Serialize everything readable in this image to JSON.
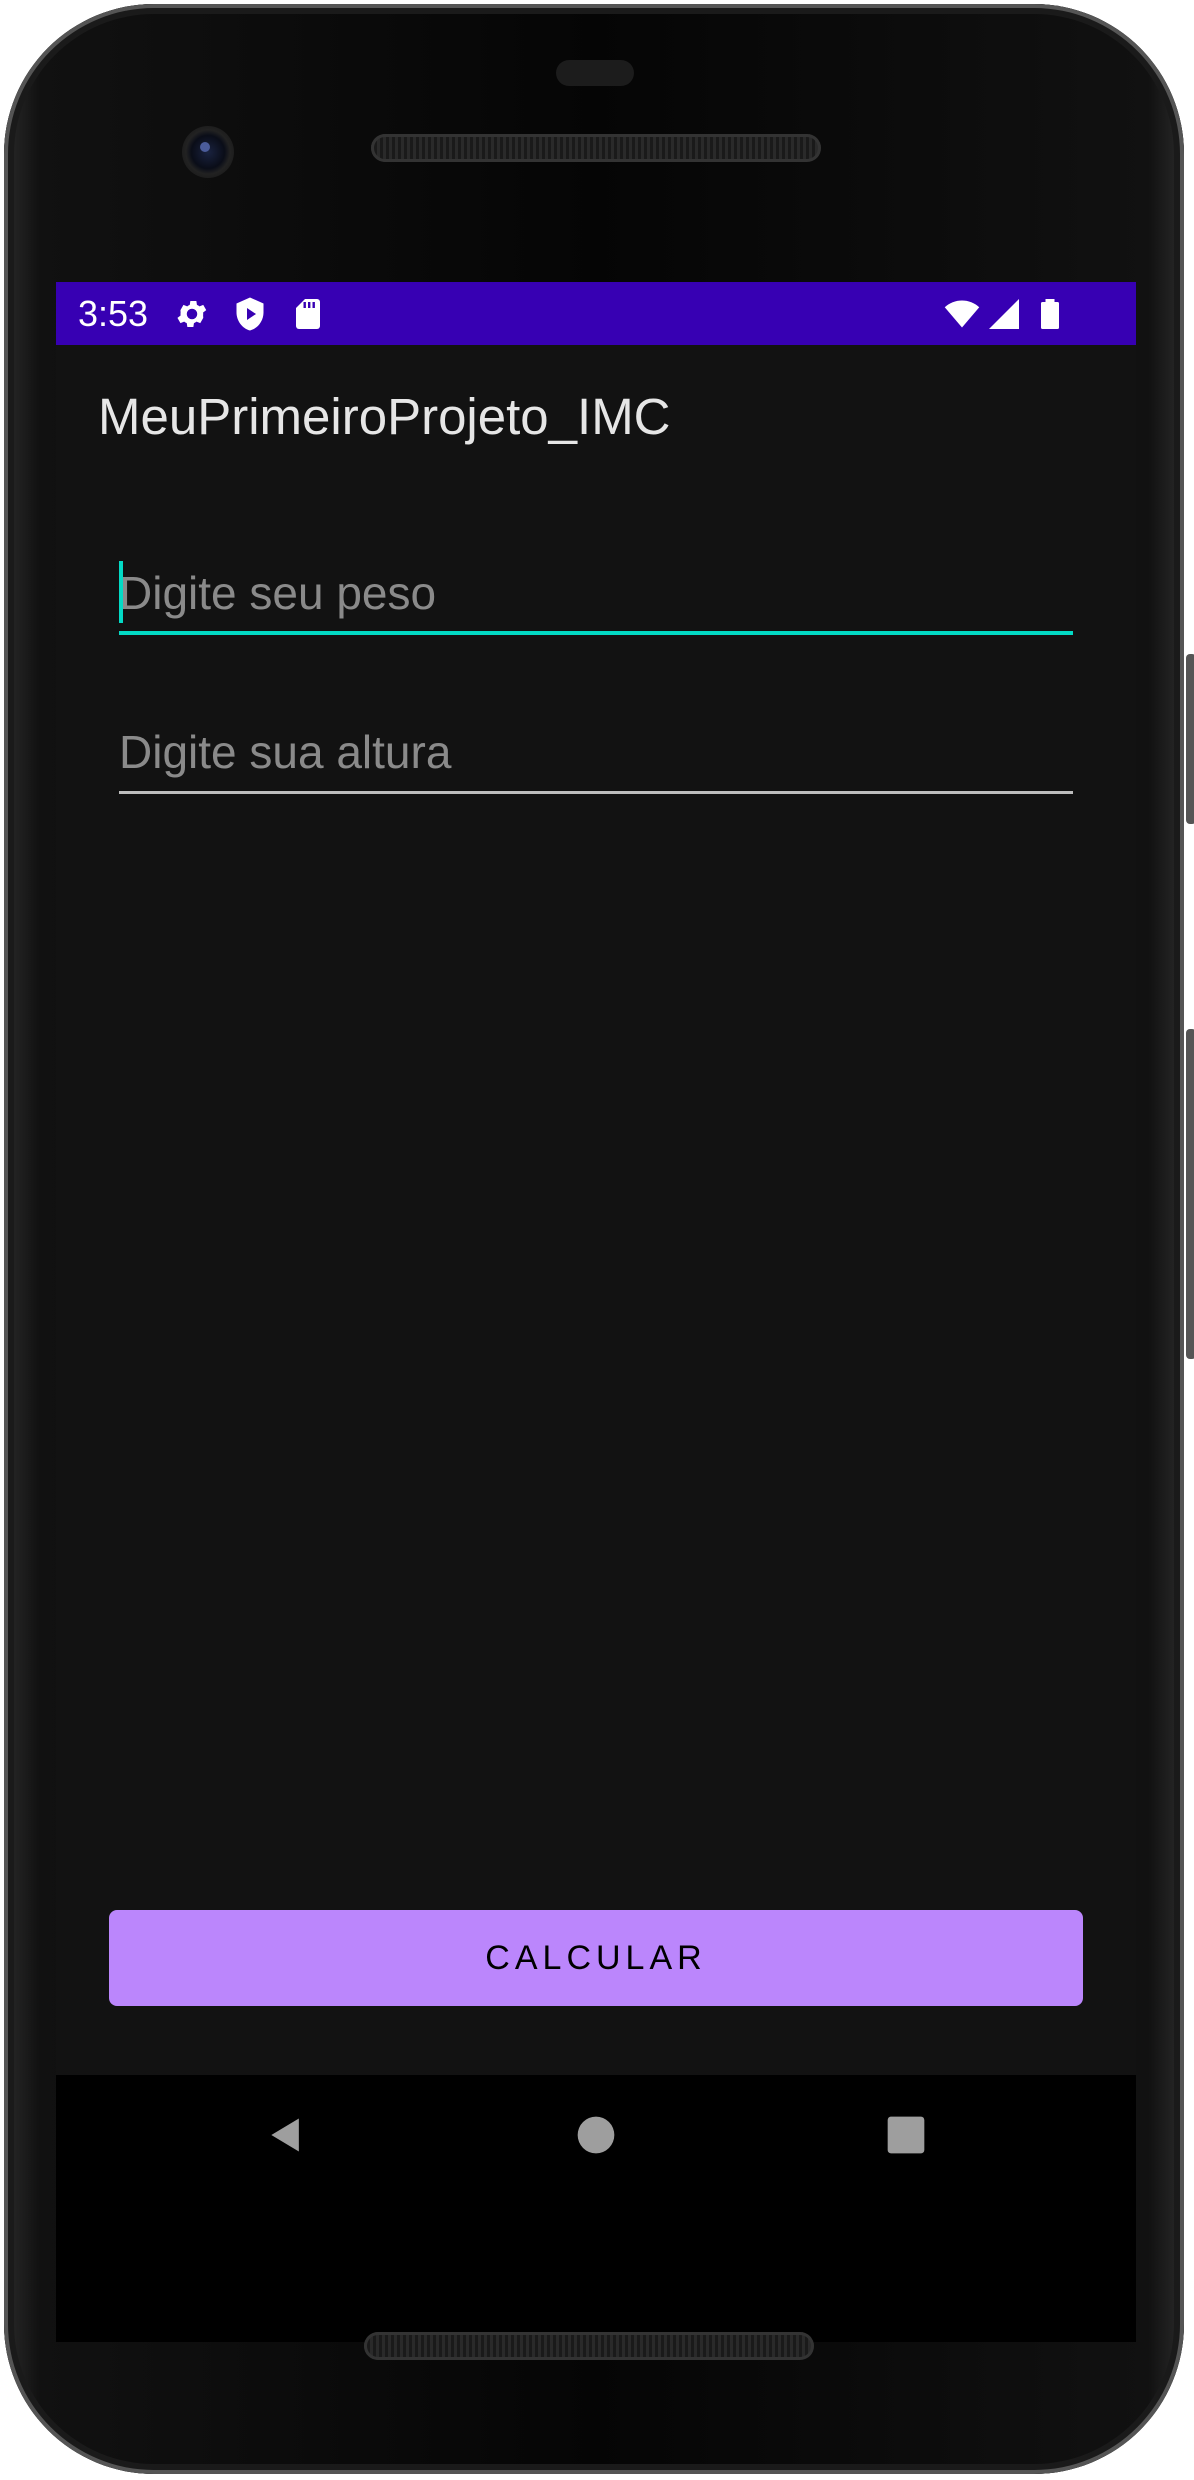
{
  "status_bar": {
    "time": "3:53",
    "background_color": "#3700b3",
    "left_icons": [
      "gear-icon",
      "shield-play-icon",
      "sd-card-icon"
    ],
    "right_icons": [
      "wifi-icon",
      "signal-icon",
      "battery-icon"
    ]
  },
  "app_bar": {
    "title": "MeuPrimeiroProjeto_IMC"
  },
  "form": {
    "weight": {
      "placeholder": "Digite seu peso",
      "value": "",
      "focused": true
    },
    "height": {
      "placeholder": "Digite sua altura",
      "value": "",
      "focused": false
    },
    "calculate_label": "CALCULAR"
  },
  "nav_bar": {
    "buttons": [
      "back-icon",
      "home-icon",
      "recents-icon"
    ]
  },
  "colors": {
    "background": "#121212",
    "accent": "#03dac5",
    "primary": "#bb86fc"
  }
}
